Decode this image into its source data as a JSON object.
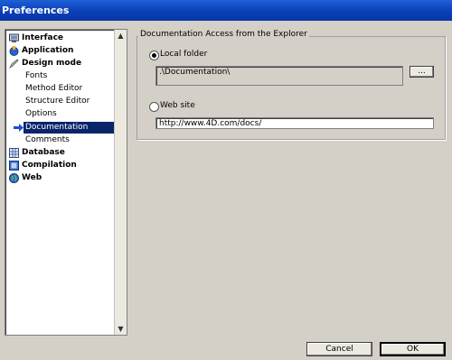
{
  "window": {
    "title": "Preferences"
  },
  "tree": {
    "items": [
      {
        "label": "Interface",
        "icon": "monitor-icon",
        "level": 0,
        "bold": true
      },
      {
        "label": "Application",
        "icon": "globe-app-icon",
        "level": 0,
        "bold": true
      },
      {
        "label": "Design mode",
        "icon": "pencil-design-icon",
        "level": 0,
        "bold": true
      },
      {
        "label": "Fonts",
        "level": 1
      },
      {
        "label": "Method Editor",
        "level": 1
      },
      {
        "label": "Structure Editor",
        "level": 1
      },
      {
        "label": "Options",
        "level": 1
      },
      {
        "label": "Documentation",
        "level": 1,
        "selected": true
      },
      {
        "label": "Comments",
        "level": 1
      },
      {
        "label": "Database",
        "icon": "database-icon",
        "level": 0,
        "bold": true
      },
      {
        "label": "Compilation",
        "icon": "compilation-icon",
        "level": 0,
        "bold": true
      },
      {
        "label": "Web",
        "icon": "web-globe-icon",
        "level": 0,
        "bold": true
      }
    ]
  },
  "doc_group": {
    "legend": "Documentation Access from the Explorer",
    "local_folder_label": "Local folder",
    "local_folder_value": ".\\Documentation\\",
    "browse_label": "...",
    "web_site_label": "Web site",
    "web_site_value": "http://www.4D.com/docs/",
    "selected": "Local folder"
  },
  "buttons": {
    "cancel": "Cancel",
    "ok": "OK"
  },
  "colors": {
    "title_bar": "#0a3fb8",
    "selection": "#0a246a",
    "dialog_bg": "#d4d0c8"
  }
}
